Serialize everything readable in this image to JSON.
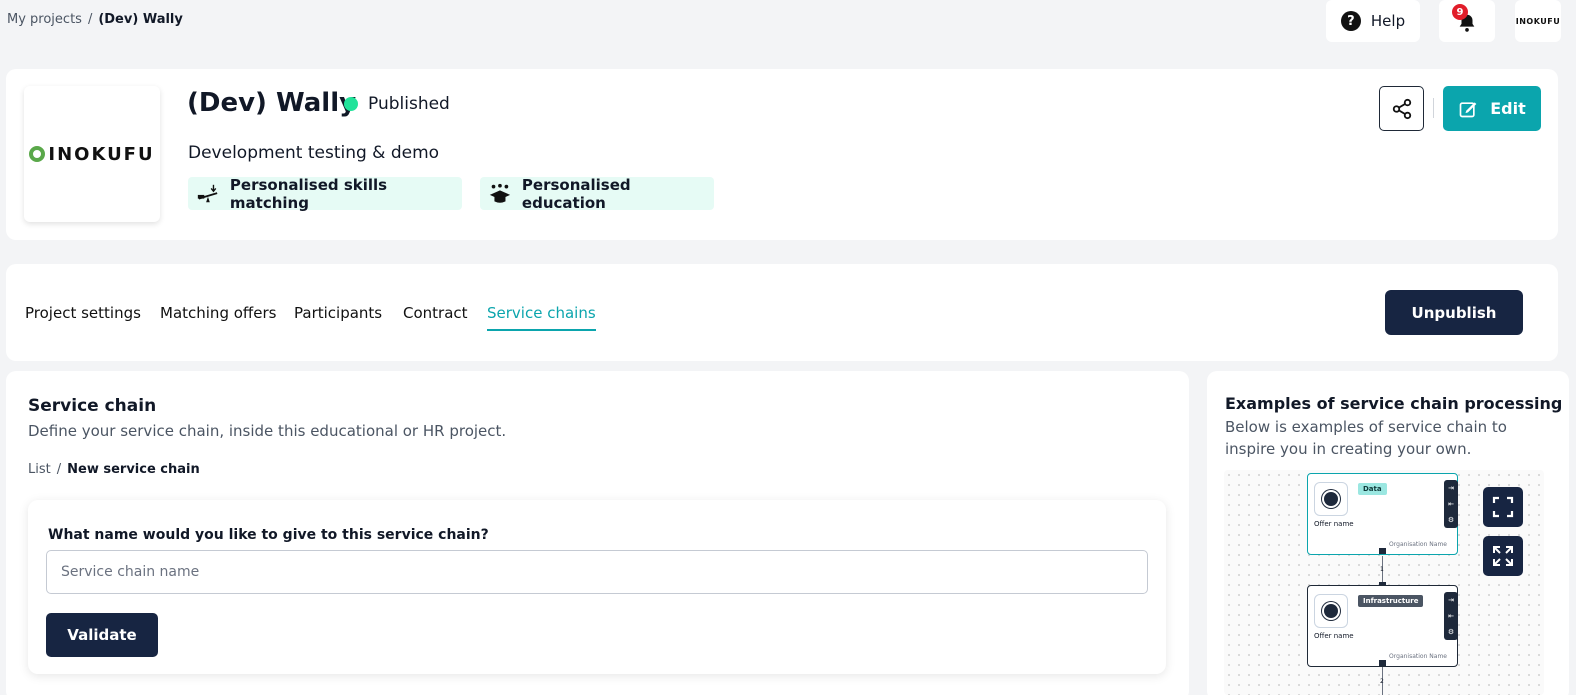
{
  "breadcrumb": {
    "root": "My projects",
    "separator": "/",
    "current": "(Dev) Wally"
  },
  "topbar": {
    "help_label": "Help",
    "notification_count": "9",
    "avatar_text": "INOKUFU"
  },
  "project": {
    "logo_text": "INOKUFU",
    "title": "(Dev) Wally",
    "status": "Published",
    "status_color": "#22e39a",
    "description": "Development testing & demo",
    "tags": [
      {
        "label": "Personalised skills matching",
        "icon": "balance-scale-icon"
      },
      {
        "label": "Personalised education",
        "icon": "graduation-cap-icon"
      }
    ],
    "edit_label": "Edit"
  },
  "tabs": [
    {
      "label": "Project settings"
    },
    {
      "label": "Matching offers"
    },
    {
      "label": "Participants"
    },
    {
      "label": "Contract"
    },
    {
      "label": "Service chains",
      "active": true
    }
  ],
  "unpublish_label": "Unpublish",
  "service_chain": {
    "title": "Service chain",
    "description": "Define your service chain, inside this educational or HR project.",
    "breadcrumb": {
      "root": "List",
      "separator": "/",
      "current": "New service chain"
    },
    "form": {
      "question": "What name would you like to give to this service chain?",
      "placeholder": "Service chain name",
      "value": "",
      "validate_label": "Validate"
    }
  },
  "examples": {
    "title": "Examples of service chain processing",
    "description": "Below is examples of service chain to inspire you in creating your own.",
    "nodes": [
      {
        "tag": "Data",
        "offer_name": "Offer name",
        "org_name": "Organisation Name",
        "step": "1"
      },
      {
        "tag": "Infrastructure",
        "offer_name": "Offer name",
        "org_name": "Organisation Name",
        "step": "2"
      }
    ]
  },
  "colors": {
    "accent": "#0ba5ad",
    "primary_dark": "#172542",
    "tag_bg": "#e6fbf5"
  }
}
